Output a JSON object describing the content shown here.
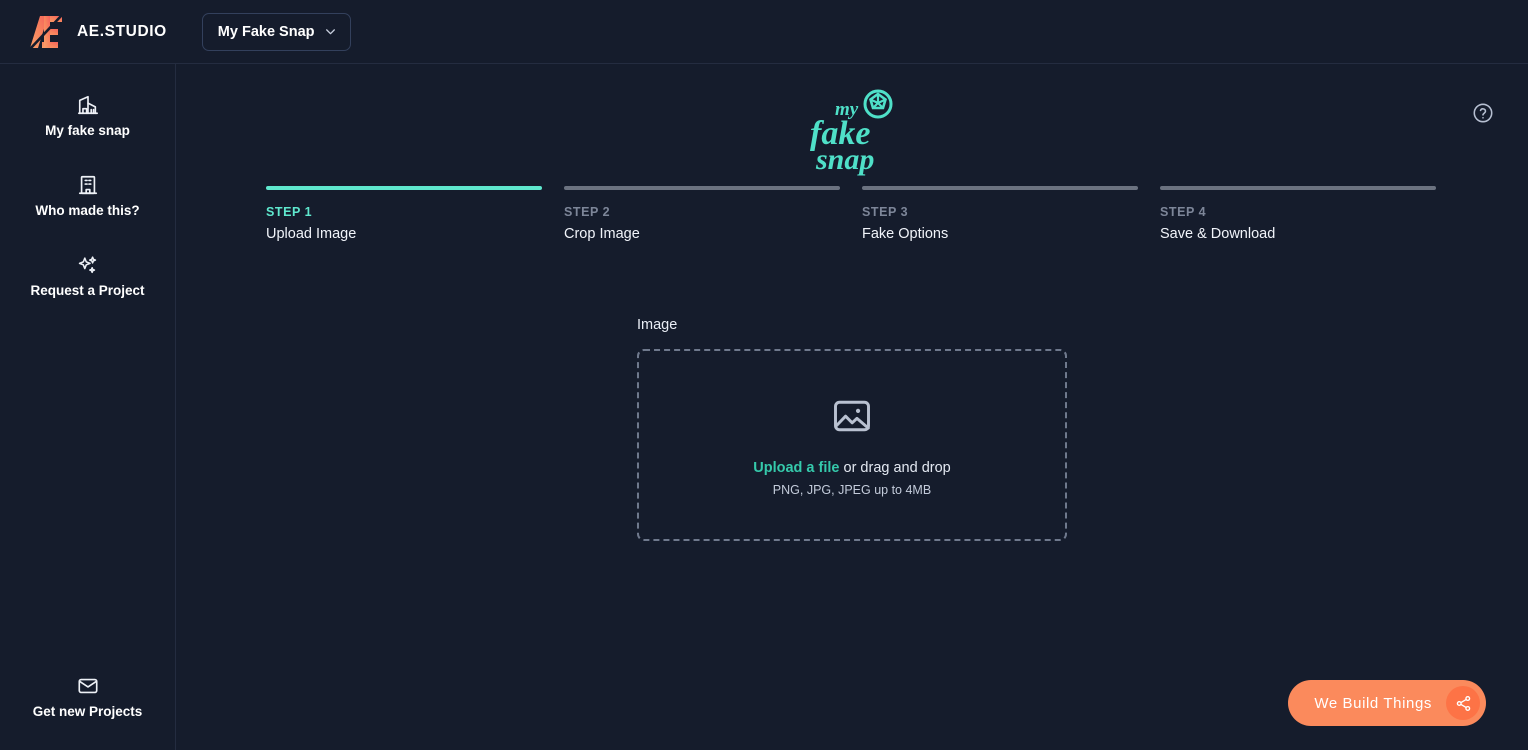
{
  "header": {
    "brand_name": "AE.STUDIO",
    "brand_logo_icon": "ae-studio-logo",
    "workspace": {
      "label": "My Fake Snap",
      "chevron_icon": "chevron-down-icon"
    }
  },
  "sidebar": {
    "items": [
      {
        "label": "My fake snap",
        "icon": "building-home-icon"
      },
      {
        "label": "Who made this?",
        "icon": "office-building-icon"
      },
      {
        "label": "Request a Project",
        "icon": "sparkles-icon"
      }
    ],
    "bottom_item": {
      "label": "Get new Projects",
      "icon": "envelope-icon"
    }
  },
  "main": {
    "help_icon": "question-circle-icon",
    "logo_alt": "my fake snap",
    "logo_icon": "camera-shutter-icon",
    "logo_text_line1": "my",
    "logo_text_line2": "fake",
    "logo_text_line3": "snap",
    "steps": [
      {
        "number": "STEP 1",
        "name": "Upload Image",
        "active": true
      },
      {
        "number": "STEP 2",
        "name": "Crop Image",
        "active": false
      },
      {
        "number": "STEP 3",
        "name": "Fake Options",
        "active": false
      },
      {
        "number": "STEP 4",
        "name": "Save & Download",
        "active": false
      }
    ],
    "upload": {
      "field_label": "Image",
      "dropzone_icon": "image-photo-icon",
      "link_text": "Upload a file",
      "drag_text": " or drag and drop",
      "hint": "PNG, JPG, JPEG up to 4MB"
    },
    "cta": {
      "label": "We Build Things",
      "share_icon": "share-nodes-icon"
    }
  },
  "colors": {
    "background": "#151c2c",
    "border": "#242c40",
    "accent_teal": "#5fe8ce",
    "link_teal": "#35c9ab",
    "inactive_gray": "#6b7280",
    "cta_orange": "#fb8a5c",
    "cta_orange_dark": "#fd7346",
    "logo_orange": "#f98b60"
  }
}
